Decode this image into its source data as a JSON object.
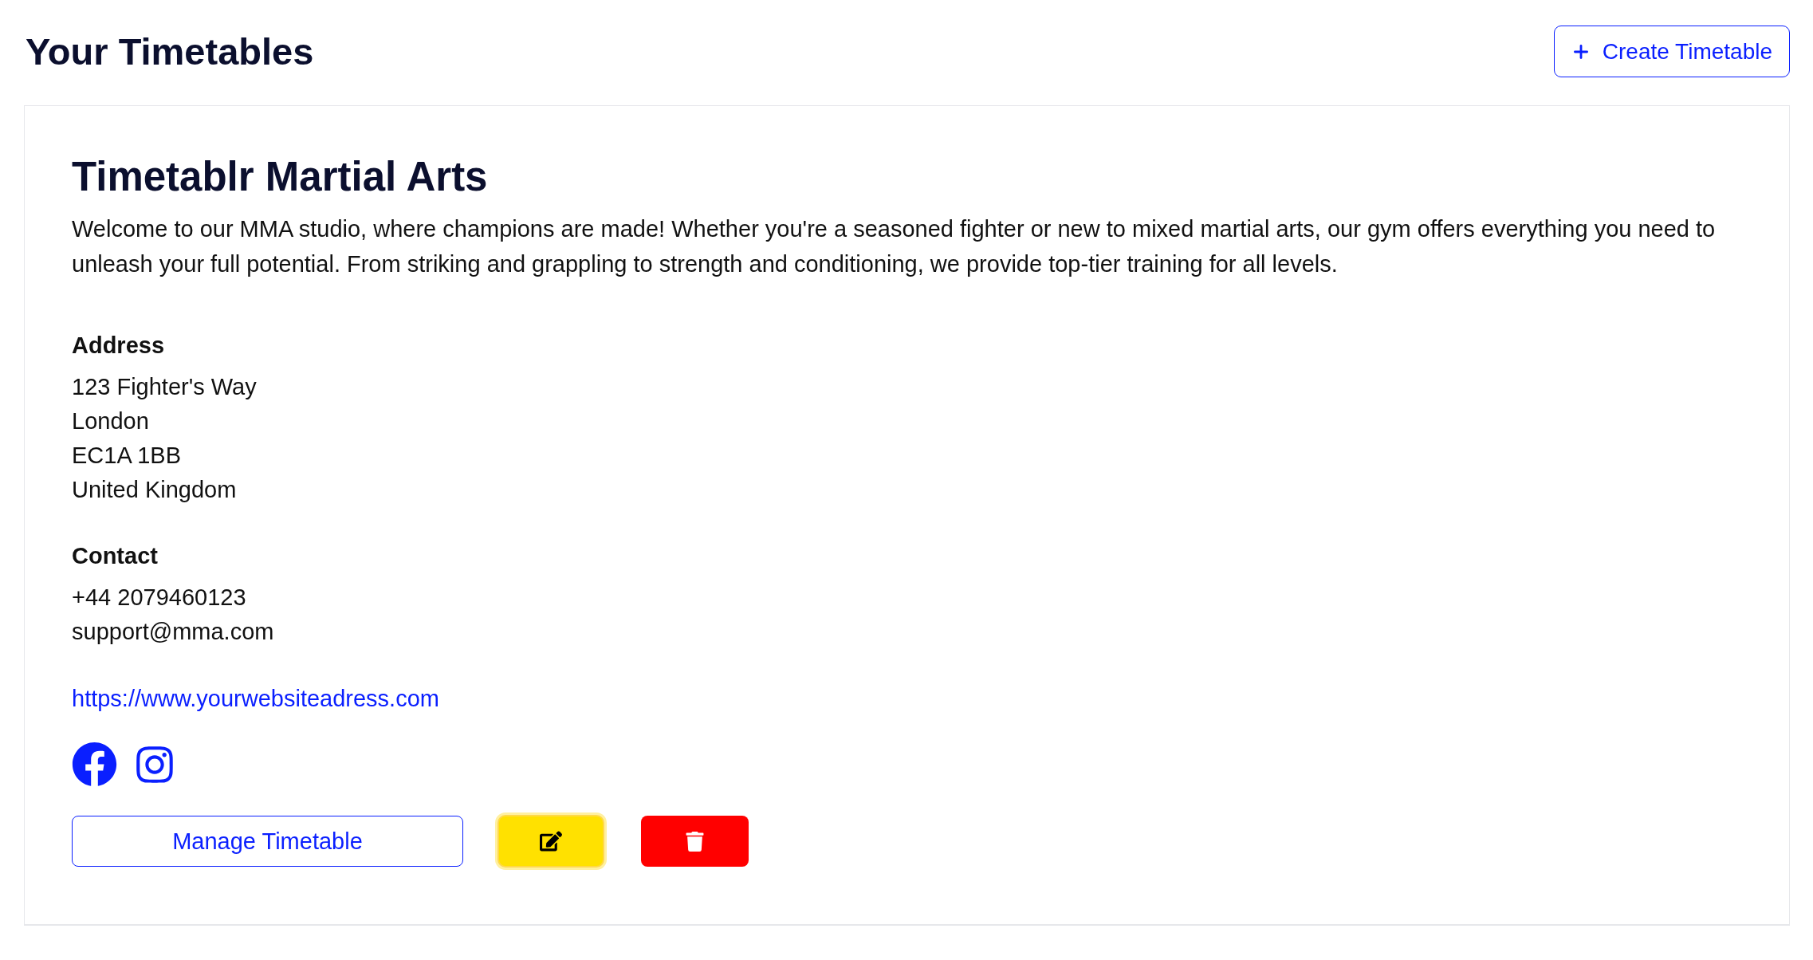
{
  "page": {
    "title": "Your Timetables"
  },
  "create_button": {
    "label": "Create Timetable"
  },
  "timetables": [
    {
      "name": "Timetablr Martial Arts",
      "description": "Welcome to our MMA studio, where champions are made! Whether you're a seasoned fighter or new to mixed martial arts, our gym offers everything you need to unleash your full potential. From striking and grappling to strength and conditioning, we provide top-tier training for all levels.",
      "address": {
        "heading": "Address",
        "lines": [
          "123 Fighter's Way",
          "London",
          "EC1A 1BB",
          "United Kingdom"
        ]
      },
      "contact": {
        "heading": "Contact",
        "lines": [
          "+44 2079460123",
          "support@mma.com"
        ]
      },
      "website": "https://www.yourwebsiteadress.com",
      "socials": [
        {
          "kind": "facebook"
        },
        {
          "kind": "instagram"
        }
      ],
      "actions": [
        {
          "kind": "manage",
          "label": "Manage Timetable"
        },
        {
          "kind": "edit",
          "focused": true
        },
        {
          "kind": "delete"
        }
      ]
    }
  ]
}
